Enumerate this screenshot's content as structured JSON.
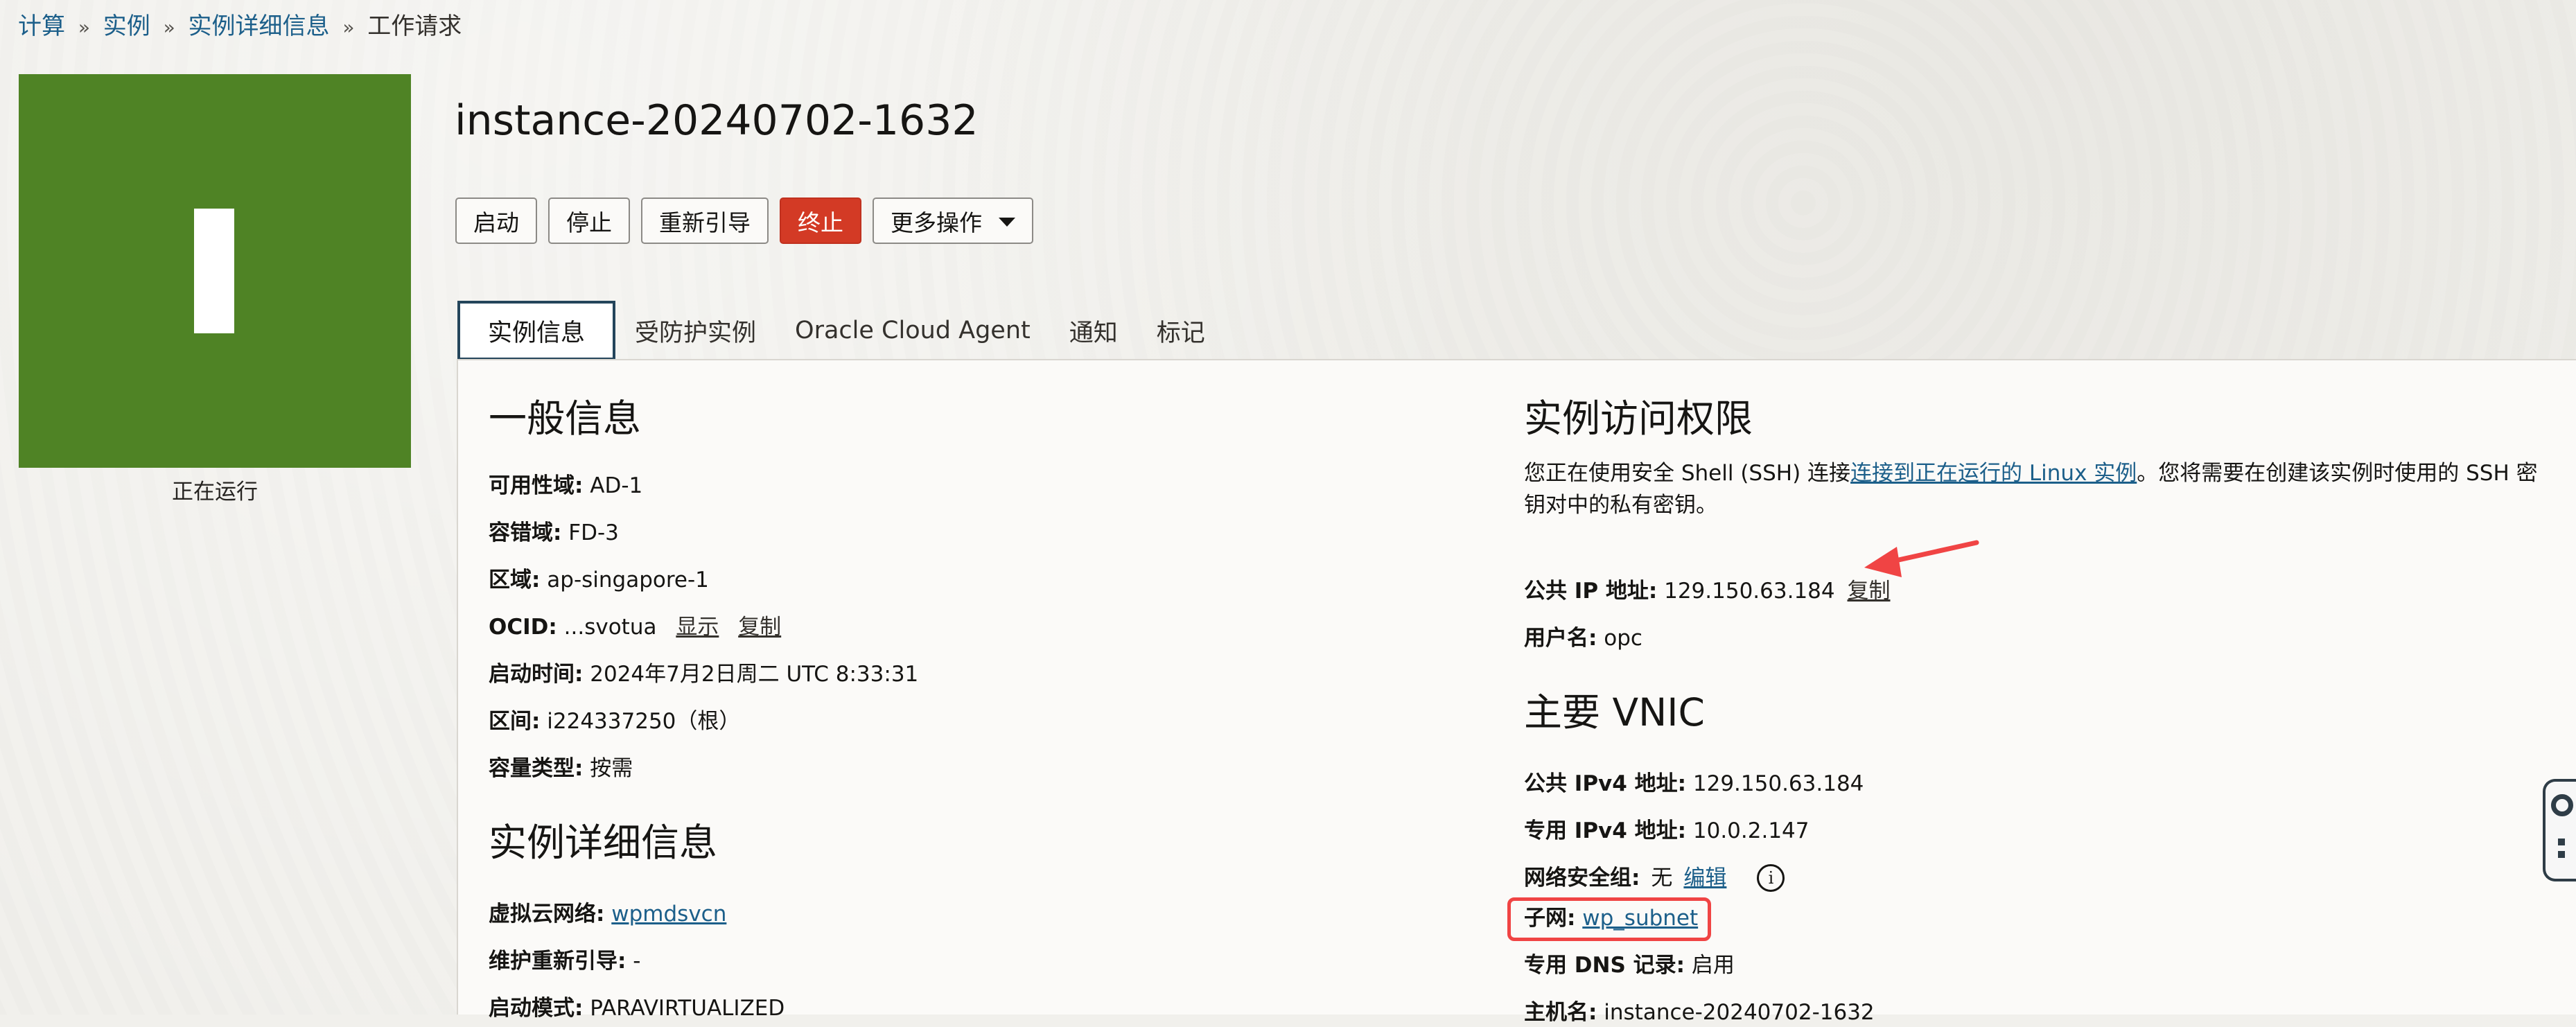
{
  "breadcrumb": {
    "items": [
      {
        "label": "计算"
      },
      {
        "label": "实例"
      },
      {
        "label": "实例详细信息"
      },
      {
        "label": "工作请求"
      }
    ],
    "separator": "»"
  },
  "instance": {
    "status": "正在运行",
    "title": "instance-20240702-1632"
  },
  "actions": {
    "start": "启动",
    "stop": "停止",
    "reboot": "重新引导",
    "terminate": "终止",
    "more": "更多操作"
  },
  "tabs": [
    {
      "label": "实例信息",
      "active": true
    },
    {
      "label": "受防护实例",
      "active": false
    },
    {
      "label": "Oracle Cloud Agent",
      "active": false
    },
    {
      "label": "通知",
      "active": false
    },
    {
      "label": "标记",
      "active": false
    }
  ],
  "general_info": {
    "title": "一般信息",
    "fields": [
      {
        "label": "可用性域:",
        "value": "AD-1"
      },
      {
        "label": "容错域:",
        "value": "FD-3"
      },
      {
        "label": "区域:",
        "value": "ap-singapore-1"
      },
      {
        "label": "OCID:",
        "value": "...svotua",
        "show": "显示",
        "copy": "复制"
      },
      {
        "label": "启动时间:",
        "value": "2024年7月2日周二 UTC 8:33:31"
      },
      {
        "label": "区间:",
        "value": "i224337250（根）"
      },
      {
        "label": "容量类型:",
        "value": "按需"
      }
    ]
  },
  "instance_details": {
    "title": "实例详细信息",
    "fields": [
      {
        "label": "虚拟云网络:",
        "value": "wpmdsvcn"
      },
      {
        "label": "维护重新引导:",
        "value": "-"
      },
      {
        "label": "启动模式:",
        "value": "PARAVIRTUALIZED"
      }
    ]
  },
  "access": {
    "title": "实例访问权限",
    "desc_prefix": "您正在使用安全 Shell (SSH) 连接",
    "desc_link": "连接到正在运行的 Linux 实例",
    "desc_suffix": "。您将需要在创建该实例时使用的 SSH 密钥对中的私有密钥。",
    "public_ip_label": "公共 IP 地址:",
    "public_ip_value": "129.150.63.184",
    "public_ip_copy": "复制",
    "username_label": "用户名:",
    "username_value": "opc"
  },
  "primary_vnic": {
    "title": "主要 VNIC",
    "public_ipv4_label": "公共 IPv4 地址:",
    "public_ipv4_value": "129.150.63.184",
    "private_ipv4_label": "专用 IPv4 地址:",
    "private_ipv4_value": "10.0.2.147",
    "nsg_label": "网络安全组:",
    "nsg_value": "无",
    "nsg_edit": "编辑",
    "subnet_label": "子网:",
    "subnet_value": "wp_subnet",
    "private_dns_label": "专用 DNS 记录:",
    "private_dns_value": "启用",
    "hostname_label": "主机名:",
    "hostname_value": "instance-20240702-1632"
  },
  "colors": {
    "tile_green": "#4f8325",
    "danger_red": "#d33a25",
    "link_blue": "#1c5f8a",
    "annotation_red": "#f04444"
  },
  "icons": {
    "info": "info-circle-icon",
    "caret": "chevron-down-icon",
    "arrow": "annotation-arrow-icon",
    "widget": "help-widget-icon"
  }
}
